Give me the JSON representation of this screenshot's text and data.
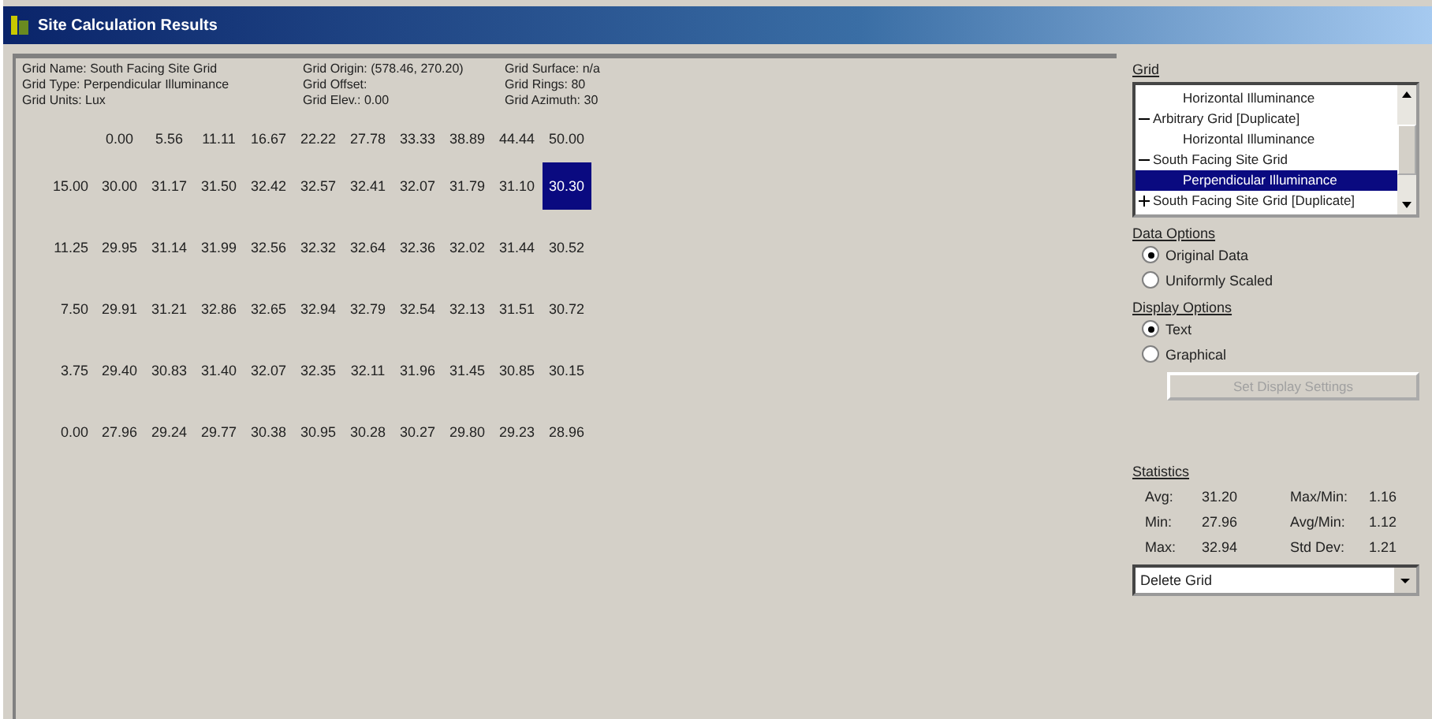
{
  "window": {
    "title": "Site Calculation Results"
  },
  "grid_info": [
    {
      "label": "Grid Name: South Facing Site Grid"
    },
    {
      "label": "Grid Origin: (578.46, 270.20)"
    },
    {
      "label": "Grid Surface: n/a"
    },
    {
      "label": "Grid Type: Perpendicular Illuminance"
    },
    {
      "label": "Grid Offset:"
    },
    {
      "label": "Grid Rings: 80"
    },
    {
      "label": "Grid Units: Lux"
    },
    {
      "label": "Grid Elev.: 0.00"
    },
    {
      "label": "Grid Azimuth: 30"
    }
  ],
  "grid": {
    "x_labels": [
      "0.00",
      "5.56",
      "11.11",
      "16.67",
      "22.22",
      "27.78",
      "33.33",
      "38.89",
      "44.44",
      "50.00"
    ],
    "rows": [
      {
        "y_label": "15.00",
        "cells": [
          {
            "value": "30.00",
            "selected": false
          },
          {
            "value": "31.17",
            "selected": false
          },
          {
            "value": "31.50",
            "selected": false
          },
          {
            "value": "32.42",
            "selected": false
          },
          {
            "value": "32.57",
            "selected": false
          },
          {
            "value": "32.41",
            "selected": false
          },
          {
            "value": "32.07",
            "selected": false
          },
          {
            "value": "31.79",
            "selected": false
          },
          {
            "value": "31.10",
            "selected": false
          },
          {
            "value": "30.30",
            "selected": true
          }
        ]
      },
      {
        "y_label": "11.25",
        "cells": [
          {
            "value": "29.95",
            "selected": false
          },
          {
            "value": "31.14",
            "selected": false
          },
          {
            "value": "31.99",
            "selected": false
          },
          {
            "value": "32.56",
            "selected": false
          },
          {
            "value": "32.32",
            "selected": false
          },
          {
            "value": "32.64",
            "selected": false
          },
          {
            "value": "32.36",
            "selected": false
          },
          {
            "value": "32.02",
            "selected": false
          },
          {
            "value": "31.44",
            "selected": false
          },
          {
            "value": "30.52",
            "selected": false
          }
        ]
      },
      {
        "y_label": "7.50",
        "cells": [
          {
            "value": "29.91",
            "selected": false
          },
          {
            "value": "31.21",
            "selected": false
          },
          {
            "value": "32.86",
            "selected": false
          },
          {
            "value": "32.65",
            "selected": false
          },
          {
            "value": "32.94",
            "selected": false
          },
          {
            "value": "32.79",
            "selected": false
          },
          {
            "value": "32.54",
            "selected": false
          },
          {
            "value": "32.13",
            "selected": false
          },
          {
            "value": "31.51",
            "selected": false
          },
          {
            "value": "30.72",
            "selected": false
          }
        ]
      },
      {
        "y_label": "3.75",
        "cells": [
          {
            "value": "29.40",
            "selected": false
          },
          {
            "value": "30.83",
            "selected": false
          },
          {
            "value": "31.40",
            "selected": false
          },
          {
            "value": "32.07",
            "selected": false
          },
          {
            "value": "32.35",
            "selected": false
          },
          {
            "value": "32.11",
            "selected": false
          },
          {
            "value": "31.96",
            "selected": false
          },
          {
            "value": "31.45",
            "selected": false
          },
          {
            "value": "30.85",
            "selected": false
          },
          {
            "value": "30.15",
            "selected": false
          }
        ]
      },
      {
        "y_label": "0.00",
        "cells": [
          {
            "value": "27.96",
            "selected": false
          },
          {
            "value": "29.24",
            "selected": false
          },
          {
            "value": "29.77",
            "selected": false
          },
          {
            "value": "30.38",
            "selected": false
          },
          {
            "value": "30.95",
            "selected": false
          },
          {
            "value": "30.28",
            "selected": false
          },
          {
            "value": "30.27",
            "selected": false
          },
          {
            "value": "29.80",
            "selected": false
          },
          {
            "value": "29.23",
            "selected": false
          },
          {
            "value": "28.96",
            "selected": false
          }
        ]
      }
    ]
  },
  "grid_panel": {
    "title": "Grid",
    "tree": [
      {
        "children": [
          {
            "label": "Horizontal Illuminance",
            "selected": false
          }
        ]
      },
      {
        "label": "Arbitrary Grid [Duplicate]",
        "expanded": true,
        "selected": false,
        "children": [
          {
            "label": "Horizontal Illuminance",
            "selected": false
          }
        ]
      },
      {
        "label": "South Facing Site Grid",
        "expanded": true,
        "selected": false,
        "children": [
          {
            "label": "Perpendicular Illuminance",
            "selected": true
          }
        ]
      },
      {
        "label": "South Facing Site Grid [Duplicate]",
        "expanded": false,
        "selected": false
      }
    ]
  },
  "data_options": {
    "title": "Data Options",
    "options": [
      {
        "label": "Original Data",
        "selected": true
      },
      {
        "label": "Uniformly Scaled",
        "selected": false
      }
    ]
  },
  "display_options": {
    "title": "Display Options",
    "options": [
      {
        "label": "Text",
        "selected": true
      },
      {
        "label": "Graphical",
        "selected": false
      }
    ]
  },
  "display_settings_button": {
    "label": "Set Display Settings",
    "disabled": true
  },
  "statistics": {
    "title": "Statistics",
    "items": [
      {
        "label": "Avg:",
        "value": "31.20"
      },
      {
        "label": "Max/Min:",
        "value": "1.16"
      },
      {
        "label": "Min:",
        "value": "27.96"
      },
      {
        "label": "Avg/Min:",
        "value": "1.12"
      },
      {
        "label": "Max:",
        "value": "32.94"
      },
      {
        "label": "Std Dev:",
        "value": "1.21"
      }
    ]
  },
  "action_dropdown": {
    "value": "Delete Grid"
  }
}
